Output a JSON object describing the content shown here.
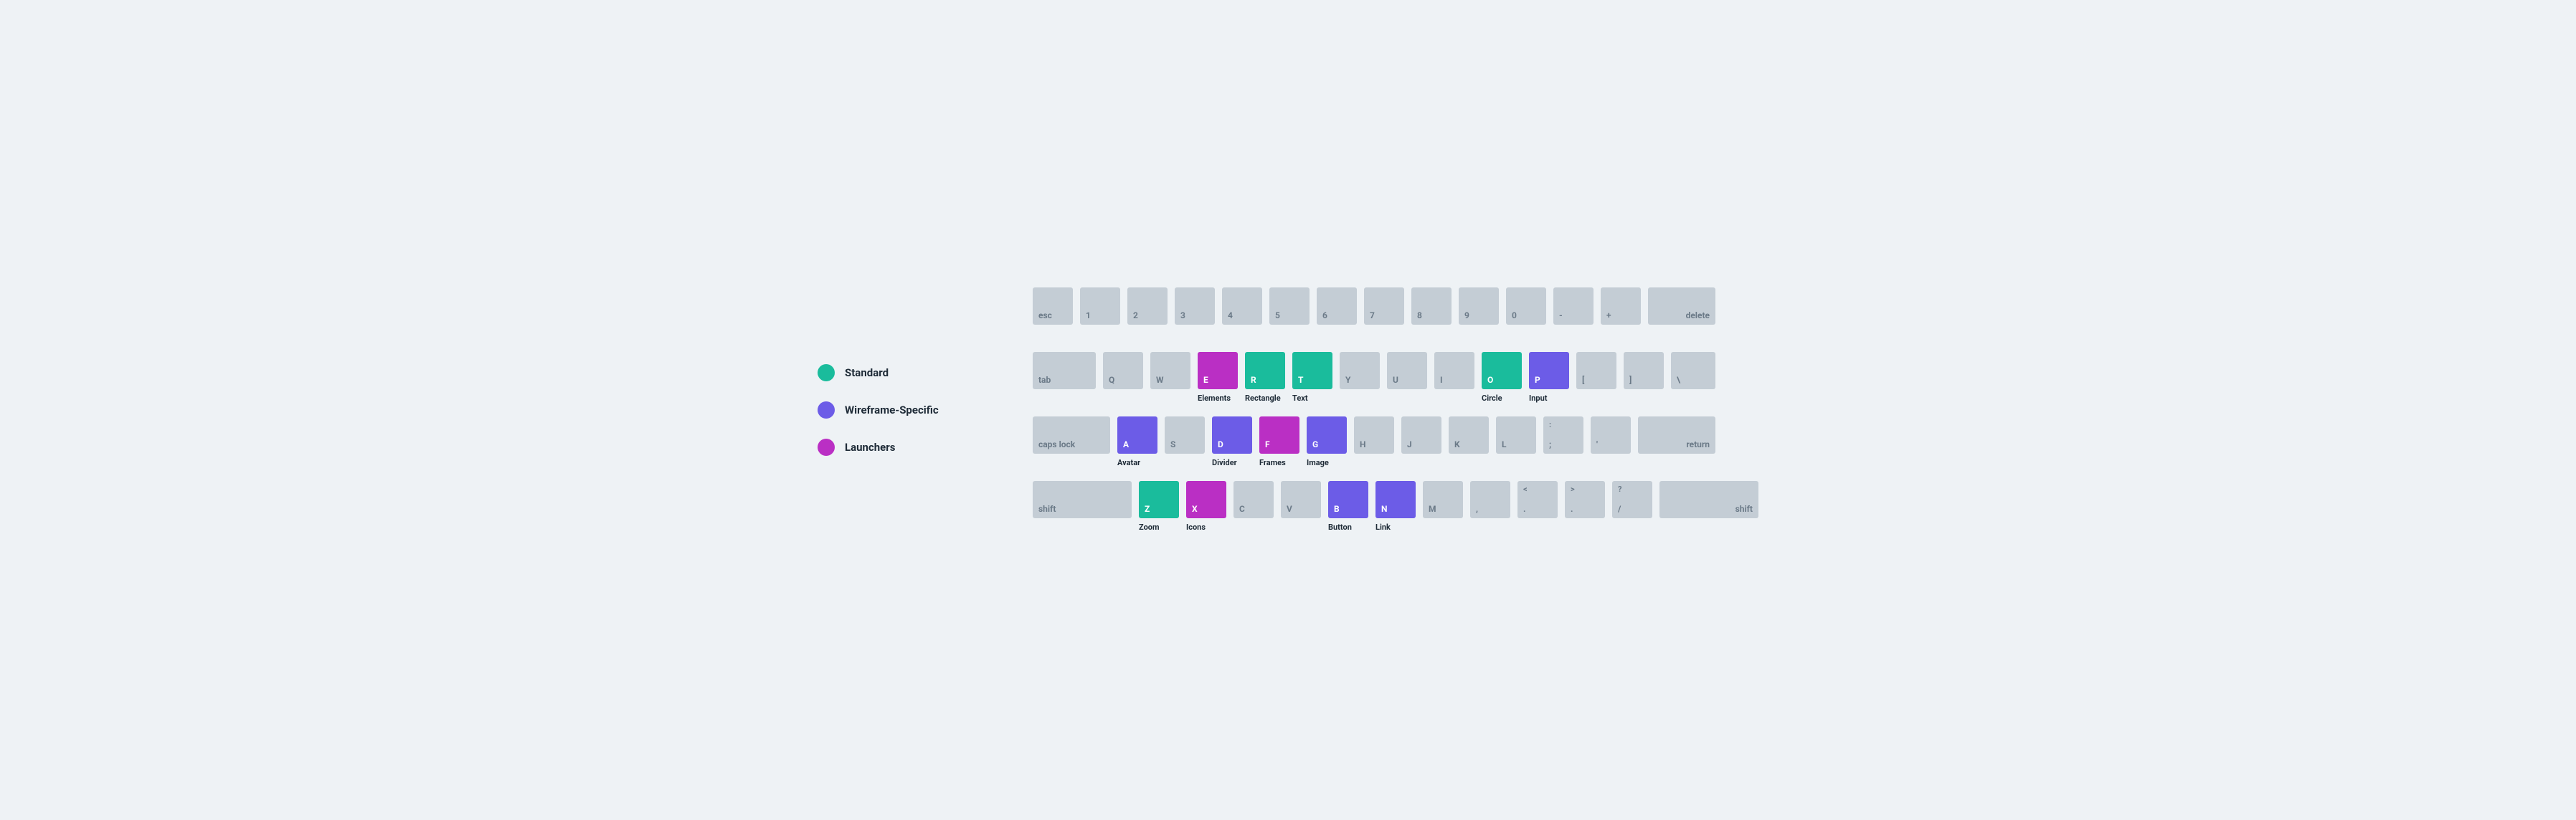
{
  "colors": {
    "standard": "#1abc9c",
    "wireframe": "#6c5ce7",
    "launcher": "#ba2fc4",
    "default_key": "#c4cdd5",
    "default_text": "#6b7a88",
    "bg": "#eef2f5"
  },
  "legend": [
    {
      "label": "Standard",
      "color_key": "standard"
    },
    {
      "label": "Wireframe-Specific",
      "color_key": "wireframe"
    },
    {
      "label": "Launchers",
      "color_key": "launcher"
    }
  ],
  "rows": [
    [
      {
        "key": "esc",
        "w": 56,
        "align": "lower-left",
        "cat": "default"
      },
      {
        "key": "1",
        "w": 56,
        "cat": "default"
      },
      {
        "key": "2",
        "w": 56,
        "cat": "default"
      },
      {
        "key": "3",
        "w": 56,
        "cat": "default"
      },
      {
        "key": "4",
        "w": 56,
        "cat": "default"
      },
      {
        "key": "5",
        "w": 56,
        "cat": "default"
      },
      {
        "key": "6",
        "w": 56,
        "cat": "default"
      },
      {
        "key": "7",
        "w": 56,
        "cat": "default"
      },
      {
        "key": "8",
        "w": 56,
        "cat": "default"
      },
      {
        "key": "9",
        "w": 56,
        "cat": "default"
      },
      {
        "key": "0",
        "w": 56,
        "cat": "default"
      },
      {
        "key": "-",
        "w": 56,
        "cat": "default"
      },
      {
        "key": "+",
        "w": 56,
        "cat": "default"
      },
      {
        "key": "delete",
        "w": 94,
        "align": "lower-right",
        "cat": "default"
      }
    ],
    [
      {
        "key": "tab",
        "w": 88,
        "align": "lower-left",
        "cat": "default"
      },
      {
        "key": "Q",
        "w": 56,
        "cat": "default"
      },
      {
        "key": "W",
        "w": 56,
        "cat": "default"
      },
      {
        "key": "E",
        "w": 56,
        "cat": "launcher",
        "sub": "Elements"
      },
      {
        "key": "R",
        "w": 56,
        "cat": "standard",
        "sub": "Rectangle"
      },
      {
        "key": "T",
        "w": 56,
        "cat": "standard",
        "sub": "Text"
      },
      {
        "key": "Y",
        "w": 56,
        "cat": "default"
      },
      {
        "key": "U",
        "w": 56,
        "cat": "default"
      },
      {
        "key": "I",
        "w": 56,
        "cat": "default"
      },
      {
        "key": "O",
        "w": 56,
        "cat": "standard",
        "sub": "Circle"
      },
      {
        "key": "P",
        "w": 56,
        "cat": "wireframe",
        "sub": "Input"
      },
      {
        "key": "[",
        "w": 56,
        "cat": "default"
      },
      {
        "key": "]",
        "w": 56,
        "cat": "default"
      },
      {
        "key": "\\",
        "w": 62,
        "cat": "default"
      }
    ],
    [
      {
        "key": "caps lock",
        "w": 108,
        "align": "lower-left",
        "cat": "default"
      },
      {
        "key": "A",
        "w": 56,
        "cat": "wireframe",
        "sub": "Avatar"
      },
      {
        "key": "S",
        "w": 56,
        "cat": "default"
      },
      {
        "key": "D",
        "w": 56,
        "cat": "wireframe",
        "sub": "Divider"
      },
      {
        "key": "F",
        "w": 56,
        "cat": "launcher",
        "sub": "Frames"
      },
      {
        "key": "G",
        "w": 56,
        "cat": "wireframe",
        "sub": "Image"
      },
      {
        "key": "H",
        "w": 56,
        "cat": "default"
      },
      {
        "key": "J",
        "w": 56,
        "cat": "default"
      },
      {
        "key": "K",
        "w": 56,
        "cat": "default"
      },
      {
        "key": "L",
        "w": 56,
        "cat": "default"
      },
      {
        "upper": ":",
        "key": ";",
        "w": 56,
        "cat": "default"
      },
      {
        "key": "'",
        "w": 56,
        "cat": "default"
      },
      {
        "key": "return",
        "w": 108,
        "align": "lower-right",
        "cat": "default"
      }
    ],
    [
      {
        "key": "shift",
        "w": 138,
        "align": "lower-left",
        "cat": "default"
      },
      {
        "key": "Z",
        "w": 56,
        "cat": "standard",
        "sub": "Zoom"
      },
      {
        "key": "X",
        "w": 56,
        "cat": "launcher",
        "sub": "Icons"
      },
      {
        "key": "C",
        "w": 56,
        "cat": "default"
      },
      {
        "key": "V",
        "w": 56,
        "cat": "default"
      },
      {
        "key": "B",
        "w": 56,
        "cat": "wireframe",
        "sub": "Button"
      },
      {
        "key": "N",
        "w": 56,
        "cat": "wireframe",
        "sub": "Link"
      },
      {
        "key": "M",
        "w": 56,
        "cat": "default"
      },
      {
        "key": ",",
        "w": 56,
        "cat": "default"
      },
      {
        "upper": "<",
        "key": ".",
        "w": 56,
        "cat": "default"
      },
      {
        "upper": ">",
        "key": ".",
        "w": 56,
        "cat": "default"
      },
      {
        "upper": "?",
        "key": "/",
        "w": 56,
        "cat": "default"
      },
      {
        "key": "shift",
        "w": 138,
        "align": "lower-right",
        "cat": "default"
      }
    ]
  ]
}
